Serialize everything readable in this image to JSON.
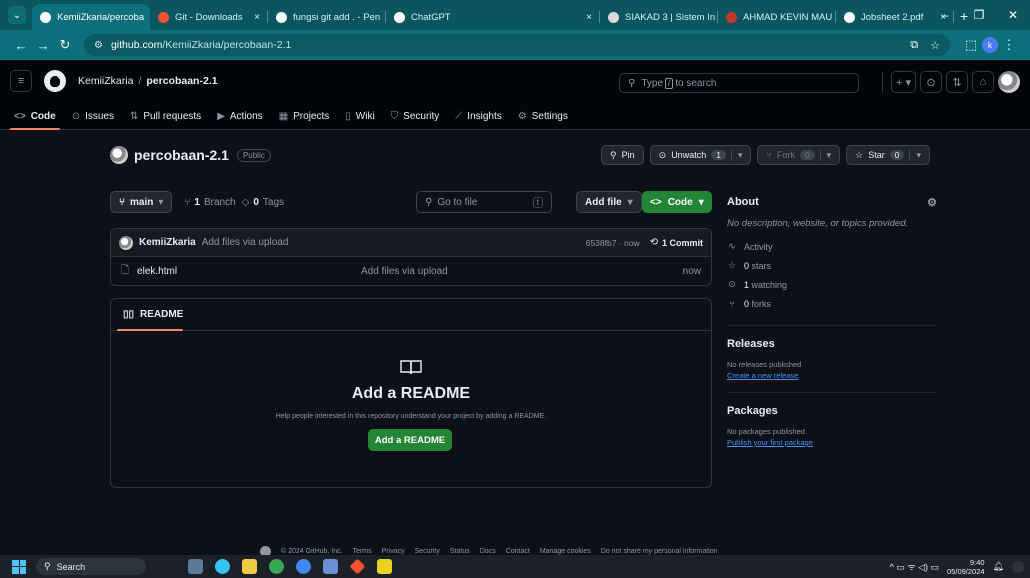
{
  "browser": {
    "tabs": [
      {
        "label": "KemiiZkaria/percoba",
        "color": "#ffffff",
        "active": true
      },
      {
        "label": "Git - Downloads",
        "color": "#f05133",
        "active": false
      },
      {
        "label": "fungsi git add . - Pen",
        "color": "#ffffff",
        "active": false
      },
      {
        "label": "ChatGPT",
        "color": "#ffffff",
        "active": false
      },
      {
        "label": "SIAKAD 3 | Sistem In",
        "color": "#d9d9d9",
        "active": false
      },
      {
        "label": "AHMAD KEVIN MAU",
        "color": "#c0392b",
        "active": false
      },
      {
        "label": "Jobsheet 2.pdf",
        "color": "#ffffff",
        "active": false
      }
    ],
    "tab_close": "×",
    "new_tab": "+",
    "url_host": "github.com",
    "url_path": "/KemiiZkaria/percobaan-2.1",
    "profile_initial": "k"
  },
  "header": {
    "owner": "KemiiZkaria",
    "separator": "/",
    "repo": "percobaan-2.1",
    "search_prefix": "Type",
    "search_key": "/",
    "search_suffix": "to search",
    "plus": "+ ▾"
  },
  "repo_nav": [
    {
      "icon": "<>",
      "label": "Code",
      "active": true
    },
    {
      "icon": "⊙",
      "label": "Issues"
    },
    {
      "icon": "⇅",
      "label": "Pull requests"
    },
    {
      "icon": "▶",
      "label": "Actions"
    },
    {
      "icon": "▦",
      "label": "Projects"
    },
    {
      "icon": "▯",
      "label": "Wiki"
    },
    {
      "icon": "⛉",
      "label": "Security"
    },
    {
      "icon": "⟋",
      "label": "Insights"
    },
    {
      "icon": "⚙",
      "label": "Settings"
    }
  ],
  "repo": {
    "title": "percobaan-2.1",
    "visibility": "Public",
    "pin": "Pin",
    "unwatch": "Unwatch",
    "watch_count": "1",
    "fork": "Fork",
    "fork_count": "0",
    "star": "Star",
    "star_count": "0"
  },
  "file_toolbar": {
    "branch": "main",
    "branch_count": "1",
    "branch_label": "Branch",
    "tag_count": "0",
    "tag_label": "Tags",
    "goto_placeholder": "Go to file",
    "goto_key": "t",
    "add_file": "Add file",
    "code": "Code"
  },
  "commit": {
    "author": "KemiiZkaria",
    "message": "Add files via upload",
    "hash": "6538fb7 · now",
    "commits": "1 Commit"
  },
  "files": [
    {
      "name": "elek.html",
      "message": "Add files via upload",
      "time": "now"
    }
  ],
  "readme": {
    "tab": "README",
    "heading": "Add a README",
    "help": "Help people interested in this repository understand your project by adding a README.",
    "button": "Add a README"
  },
  "sidebar": {
    "about_title": "About",
    "description": "No description, website, or topics provided.",
    "stats": [
      {
        "icon": "∿",
        "bold": "",
        "text": "Activity"
      },
      {
        "icon": "☆",
        "bold": "0",
        "text": "stars"
      },
      {
        "icon": "⊙",
        "bold": "1",
        "text": "watching"
      },
      {
        "icon": "⑂",
        "bold": "0",
        "text": "forks"
      }
    ],
    "releases_title": "Releases",
    "releases_text": "No releases published",
    "releases_link": "Create a new release",
    "packages_title": "Packages",
    "packages_text": "No packages published",
    "packages_link": "Publish your first package"
  },
  "footer": {
    "items": [
      "© 2024 GitHub, Inc.",
      "Terms",
      "Privacy",
      "Security",
      "Status",
      "Docs",
      "Contact",
      "Manage cookies",
      "Do not share my personal information"
    ]
  },
  "taskbar": {
    "search": "Search",
    "time": "9:40",
    "date": "05/09/2024",
    "tray": "^ ▭ ᯤ ◁) ▭"
  }
}
